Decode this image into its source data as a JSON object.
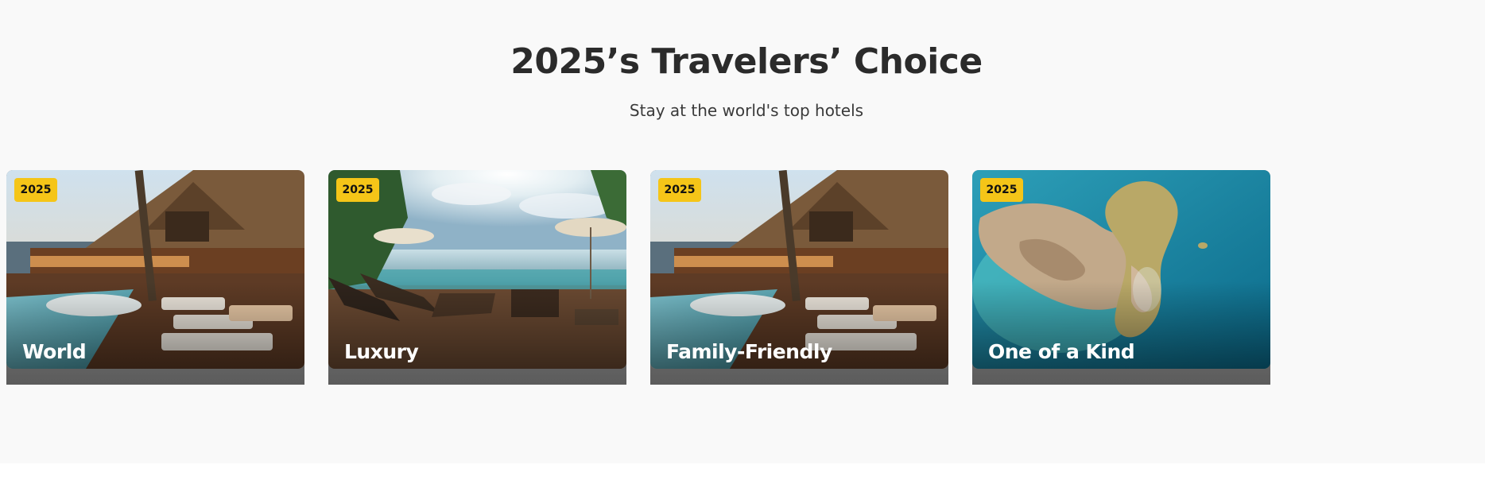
{
  "section": {
    "title": "2025’s Travelers’ Choice",
    "subtitle": "Stay at the world's top hotels"
  },
  "cards": [
    {
      "badge": "2025",
      "label": "World",
      "image": "resort-pool-image"
    },
    {
      "badge": "2025",
      "label": "Luxury",
      "image": "ocean-deck-image"
    },
    {
      "badge": "2025",
      "label": "Family-Friendly",
      "image": "resort-pool-image"
    },
    {
      "badge": "2025",
      "label": "One of a Kind",
      "image": "aerial-island-image"
    }
  ],
  "colors": {
    "background": "#f9f9f9",
    "badge": "#f5c518",
    "title": "#2b2b2b"
  }
}
